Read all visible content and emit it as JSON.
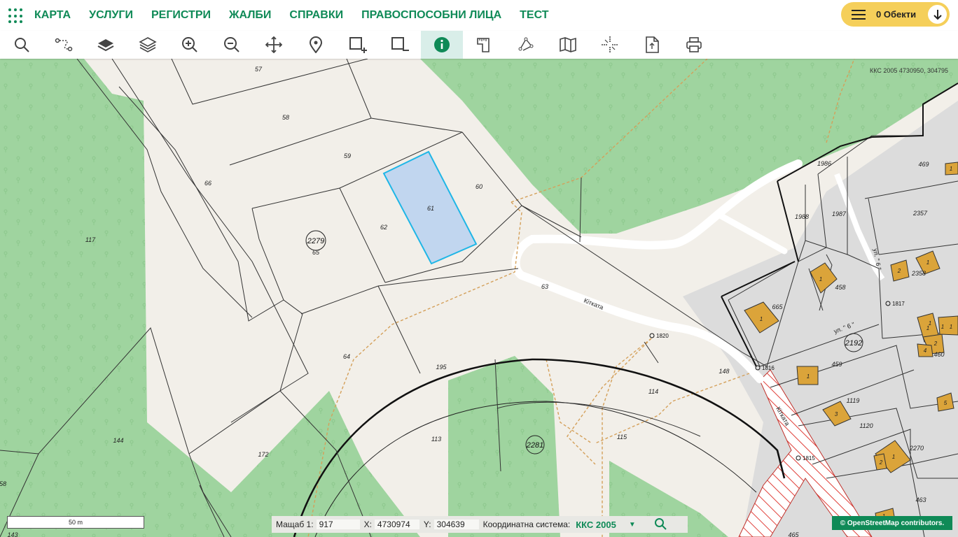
{
  "nav": {
    "items": [
      "КАРТА",
      "УСЛУГИ",
      "РЕГИСТРИ",
      "ЖАЛБИ",
      "СПРАВКИ",
      "ПРАВОСПОСОБНИ ЛИЦА",
      "ТЕСТ"
    ],
    "objects_label": "0 Обекти"
  },
  "toolbar": {
    "tools": [
      "search-icon",
      "route-icon",
      "layer-filled-icon",
      "layers-icon",
      "zoom-in-icon",
      "zoom-out-icon",
      "pan-icon",
      "pin-icon",
      "add-area-icon",
      "remove-area-icon",
      "info-icon",
      "measure-icon",
      "polyline-icon",
      "map-icon",
      "crosshair-icon",
      "export-icon",
      "print-icon"
    ],
    "active": "info-icon"
  },
  "map": {
    "coord_readout": "ККС 2005 4730950, 304795",
    "parcels": [
      "57",
      "58",
      "59",
      "60",
      "61",
      "62",
      "63",
      "64",
      "65",
      "66",
      "117",
      "144",
      "172",
      "113",
      "114",
      "115",
      "148",
      "195",
      "463",
      "465",
      "459",
      "458",
      "665",
      "1119",
      "1120",
      "2270",
      "469",
      "2357",
      "1986",
      "1987",
      "1988",
      "2358",
      "460",
      "58",
      "143"
    ],
    "blocks": [
      "2279",
      "2281",
      "2192"
    ],
    "points": [
      "1820",
      "1816",
      "1815",
      "1817"
    ],
    "streets": [
      "Кітката",
      "ул. \" 6 \"",
      "ул. \" 6 \"",
      "Кітката"
    ],
    "buildings": [
      "1",
      "1",
      "1",
      "1",
      "1",
      "2",
      "1",
      "1",
      "3",
      "1",
      "2",
      "1",
      "2",
      "4",
      "5",
      "1",
      "1"
    ],
    "selected_parcel": "61"
  },
  "scale": {
    "bar_label": "50 m"
  },
  "status": {
    "scale_label": "Мащаб 1:",
    "scale_value": "917",
    "x_label": "X:",
    "x_value": "4730974",
    "y_label": "Y:",
    "y_value": "304639",
    "crs_label": "Координатна система:",
    "crs_value": "ККС 2005"
  },
  "attribution": "© OpenStreetMap contributors.",
  "colors": {
    "brand": "#0f8a57",
    "selected_fill": "#c1d6ef",
    "selected_stroke": "#1fb6e6",
    "forest": "#9fd49f",
    "building": "#dba43a",
    "road_hatch": "#e0403a"
  }
}
